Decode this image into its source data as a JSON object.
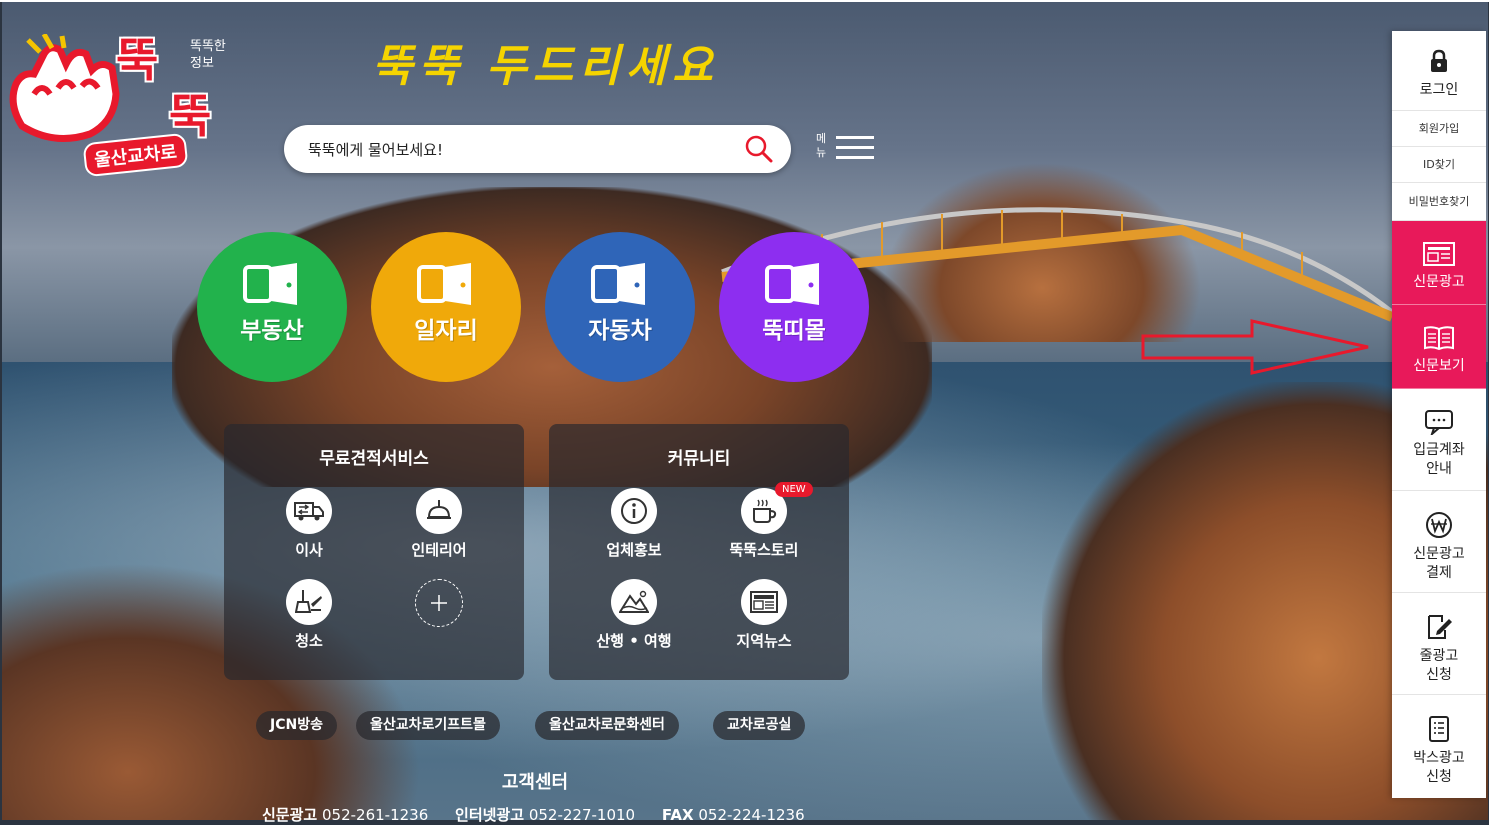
{
  "logo": {
    "big_top": "뚝",
    "big_bottom": "뚝",
    "small_text_1": "똑똑한",
    "small_text_2": "정보",
    "sub_text": "울산교차로"
  },
  "slogan": "뚝뚝 두드리세요",
  "search": {
    "placeholder": "뚝뚝에게 물어보세요!"
  },
  "menu": {
    "label_1": "메",
    "label_2": "뉴"
  },
  "circles": [
    {
      "label": "부동산",
      "color": "#22b24c"
    },
    {
      "label": "일자리",
      "color": "#f0a90a"
    },
    {
      "label": "자동차",
      "color": "#2f65b8"
    },
    {
      "label": "뚝띠몰",
      "color": "#8d2ef0"
    }
  ],
  "estimate_panel": {
    "title": "무료견적서비스",
    "items": [
      {
        "label": "이사",
        "icon": "moving-truck-icon"
      },
      {
        "label": "인테리어",
        "icon": "ceiling-lamp-icon"
      },
      {
        "label": "청소",
        "icon": "broom-icon"
      },
      {
        "label": "",
        "icon": "plus-icon"
      }
    ]
  },
  "community_panel": {
    "title": "커뮤니티",
    "items": [
      {
        "label": "업체홍보",
        "icon": "info-icon"
      },
      {
        "label": "뚝뚝스토리",
        "icon": "coffee-cup-icon",
        "badge": "NEW"
      },
      {
        "label": "산행 • 여행",
        "icon": "mountain-icon"
      },
      {
        "label": "지역뉴스",
        "icon": "newspaper-icon"
      }
    ]
  },
  "pills": [
    "JCN방송",
    "울산교차로기프트몰",
    "울산교차로문화센터",
    "교차로공실"
  ],
  "customer_center": {
    "title": "고객센터",
    "lines": [
      {
        "name": "신문광고",
        "number": "052-261-1236"
      },
      {
        "name": "인터넷광고",
        "number": "052-227-1010"
      },
      {
        "name": "FAX",
        "number": "052-224-1236"
      }
    ]
  },
  "sidebar": {
    "login": "로그인",
    "signup": "회원가입",
    "find_id": "ID찾기",
    "find_pw": "비밀번호찾기",
    "newspaper_ad": "신문광고",
    "newspaper_view": "신문보기",
    "deposit_1": "입금계좌",
    "deposit_2": "안내",
    "ad_payment_1": "신문광고",
    "ad_payment_2": "결제",
    "line_ad_1": "줄광고",
    "line_ad_2": "신청",
    "box_ad_1": "박스광고",
    "box_ad_2": "신청"
  },
  "colors": {
    "brand_red": "#e8192c",
    "sidebar_pink": "#e8195a",
    "slogan_yellow": "#f5d400"
  }
}
